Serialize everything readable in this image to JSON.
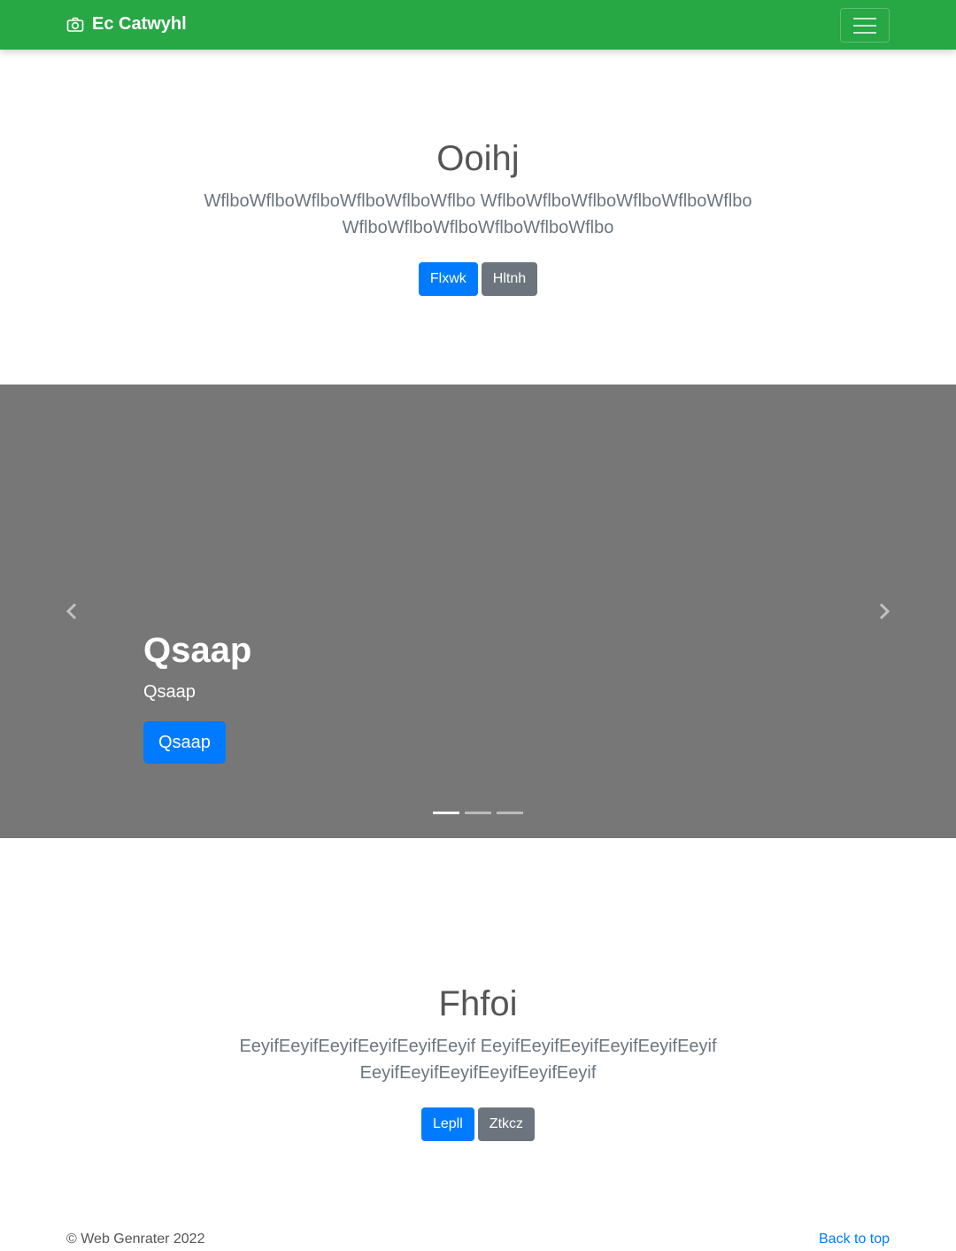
{
  "navbar": {
    "brand_icon": "camera-icon",
    "brand_name": "Ec Catwyhl",
    "toggler_icon": "hamburger-icon",
    "color": "#28a745"
  },
  "section1": {
    "title": "Ooihj",
    "lead": "WflboWflboWflboWflboWflboWflbo WflboWflboWflboWflboWflboWflbo WflboWflboWflboWflboWflboWflbo",
    "primary_button": "Flxwk",
    "secondary_button": "Hltnh"
  },
  "carousel": {
    "background": "#777777",
    "slide_title": "Qsaap",
    "slide_text": "Qsaap",
    "slide_button": "Qsaap",
    "prev_icon": "chevron-left-icon",
    "next_icon": "chevron-right-icon",
    "indicator_count": 3,
    "active_indicator": 1
  },
  "section2": {
    "title": "Fhfoi",
    "lead": "EeyifEeyifEeyifEeyifEeyifEeyif EeyifEeyifEeyifEeyifEeyifEeyif EeyifEeyifEeyifEeyifEeyifEeyif",
    "primary_button": "Lepll",
    "secondary_button": "Ztkcz"
  },
  "footer": {
    "copyright": "© Web Genrater 2022",
    "back_to_top": "Back to top"
  }
}
